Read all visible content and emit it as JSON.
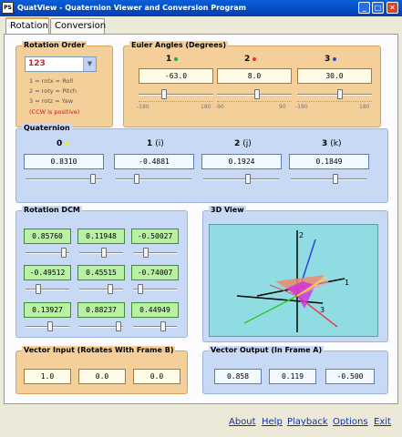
{
  "window": {
    "title": "QuatView - Quaternion Viewer and Conversion Program",
    "app_icon": "PS"
  },
  "tabs": [
    {
      "label": "Rotation"
    },
    {
      "label": "Conversion"
    }
  ],
  "rotation_order": {
    "title": "Rotation Order",
    "selected": "123",
    "notes": [
      "1 = rotx = Roll",
      "2 = roty = Pitch",
      "3 = rotz = Yaw",
      "(CCW is positive)"
    ]
  },
  "euler": {
    "title": "Euler Angles (Degrees)",
    "axes": [
      {
        "label": "1",
        "dot_color": "#22a83a",
        "value": "-63.0",
        "min": "-180",
        "max": "180",
        "level": 0.325
      },
      {
        "label": "2",
        "dot_color": "#e03030",
        "value": "8.0",
        "min": "-90",
        "max": "90",
        "level": 0.544
      },
      {
        "label": "3",
        "dot_color": "#2a3fd6",
        "value": "30.0",
        "min": "-180",
        "max": "180",
        "level": 0.583
      }
    ]
  },
  "quaternion": {
    "title": "Quaternion",
    "components": [
      {
        "index": "0",
        "suffix": "",
        "dot_color": "#f2e534",
        "value": "0.8310",
        "level": 0.915
      },
      {
        "index": "1",
        "suffix": "(i)",
        "value": "-0.4881",
        "level": 0.256
      },
      {
        "index": "2",
        "suffix": "(j)",
        "value": "0.1924",
        "level": 0.596
      },
      {
        "index": "3",
        "suffix": "(k)",
        "value": "0.1849",
        "level": 0.592
      }
    ]
  },
  "dcm": {
    "title": "Rotation DCM",
    "rows": [
      {
        "values": [
          "0.85760",
          "0.11948",
          "-0.50027"
        ],
        "levels": [
          0.929,
          0.56,
          0.25
        ]
      },
      {
        "values": [
          "-0.49512",
          "0.45515",
          "-0.74007"
        ],
        "levels": [
          0.252,
          0.728,
          0.13
        ]
      },
      {
        "values": [
          "0.13927",
          "0.88237",
          "0.44949"
        ],
        "levels": [
          0.57,
          0.941,
          0.725
        ]
      }
    ]
  },
  "view3d": {
    "title": "3D View",
    "axis_labels": [
      "1",
      "2",
      "3"
    ]
  },
  "vector_input": {
    "title": "Vector Input (Rotates With Frame B)",
    "values": [
      "1.0",
      "0.0",
      "0.0"
    ]
  },
  "vector_output": {
    "title": "Vector Output (In Frame A)",
    "values": [
      "0.858",
      "0.119",
      "-0.500"
    ]
  },
  "links": [
    "About",
    "Help",
    "Playback",
    "Options",
    "Exit"
  ]
}
